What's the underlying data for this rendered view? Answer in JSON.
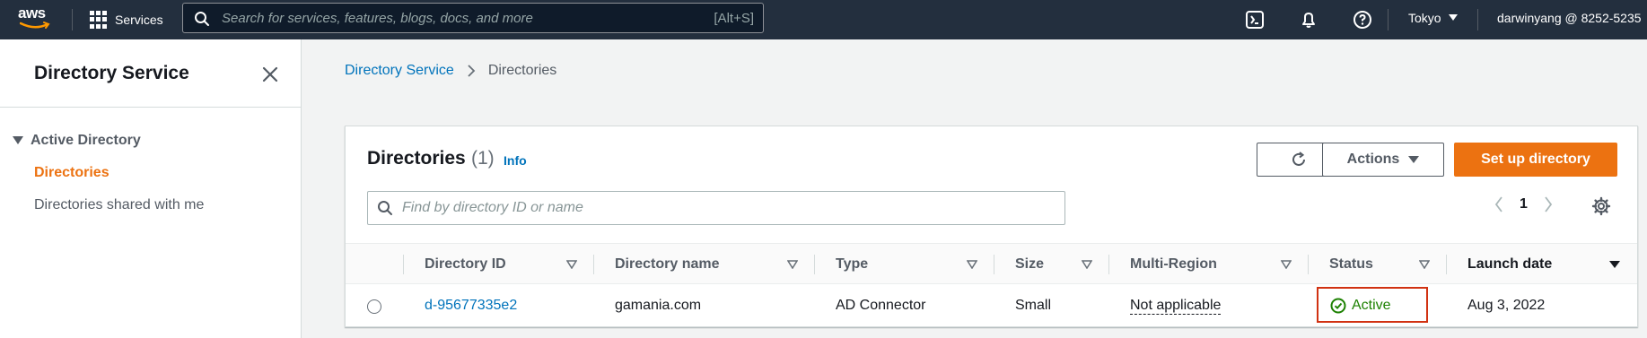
{
  "topnav": {
    "logo_text": "aws",
    "services_label": "Services",
    "search_placeholder": "Search for services, features, blogs, docs, and more",
    "search_shortcut": "[Alt+S]",
    "region": "Tokyo",
    "account": "darwinyang @ 8252-5235",
    "icons": [
      "cloudshell-icon",
      "bell-icon",
      "help-icon"
    ],
    "bg_color": "#232f3e"
  },
  "sidebar": {
    "title": "Directory Service",
    "section": "Active Directory",
    "items": [
      {
        "label": "Directories",
        "active": true
      },
      {
        "label": "Directories shared with me",
        "active": false
      }
    ]
  },
  "breadcrumb": {
    "items": [
      "Directory Service",
      "Directories"
    ]
  },
  "panel": {
    "title": "Directories",
    "count": "(1)",
    "info": "Info",
    "actions_label": "Actions",
    "primary_label": "Set up directory",
    "filter_placeholder": "Find by directory ID or name",
    "page": "1",
    "accent_color": "#ec7211"
  },
  "table": {
    "columns": [
      "Directory ID",
      "Directory name",
      "Type",
      "Size",
      "Multi-Region",
      "Status",
      "Launch date"
    ],
    "rows": [
      {
        "directory_id": "d-95677335e2",
        "directory_name": "gamania.com",
        "type": "AD Connector",
        "size": "Small",
        "multi_region": "Not applicable",
        "status": "Active",
        "launch_date": "Aug 3, 2022"
      }
    ],
    "status_color": "#1d8102",
    "highlight_color": "#d13212"
  }
}
